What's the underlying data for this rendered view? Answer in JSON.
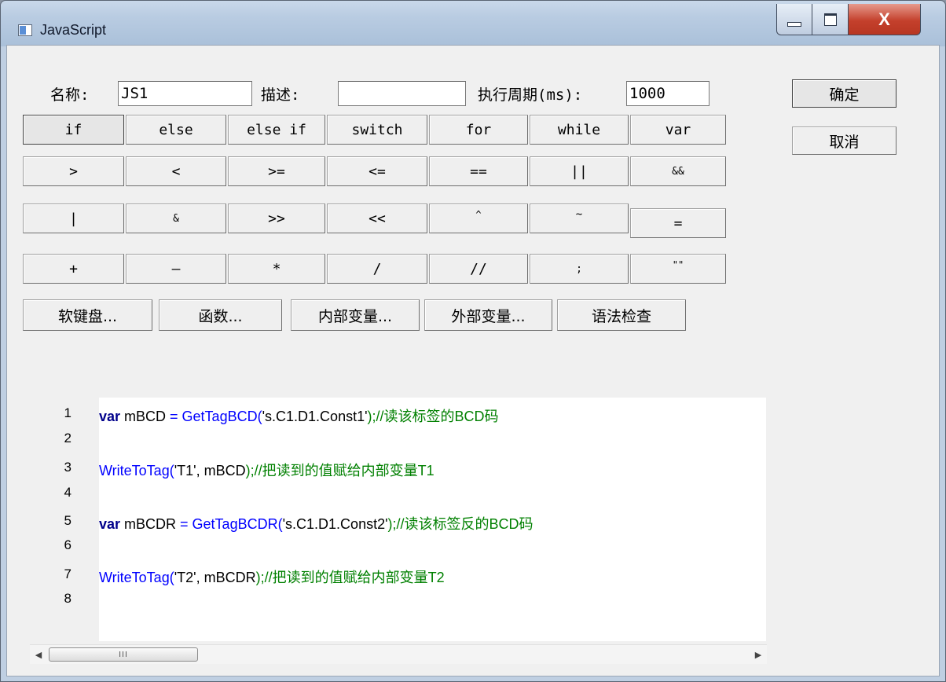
{
  "window": {
    "title": "JavaScript",
    "close_glyph": "X"
  },
  "form": {
    "name_label": "名称:",
    "name_value": "JS1",
    "desc_label": "描述:",
    "desc_value": "",
    "period_label": "执行周期(ms):",
    "period_value": "1000"
  },
  "actions": {
    "ok": "确定",
    "cancel": "取消"
  },
  "keys": {
    "row1": [
      "if",
      "else",
      "else if",
      "switch",
      "for",
      "while",
      "var"
    ],
    "row2": [
      ">",
      "<",
      ">=",
      "<=",
      "==",
      "||",
      "&&"
    ],
    "row3": [
      "|",
      "&",
      ">>",
      "<<",
      "^",
      "~",
      "="
    ],
    "row4": [
      "+",
      "—",
      "*",
      "/",
      "//",
      ";",
      "\"\""
    ]
  },
  "tools": [
    "软键盘...",
    "函数...",
    "内部变量...",
    "外部变量...",
    "语法检查"
  ],
  "editor": {
    "line_numbers": [
      "1",
      "2",
      "3",
      "4",
      "5",
      "6",
      "7",
      "8"
    ],
    "l1": {
      "kw": "var",
      "a": " mBCD ",
      "op": "=",
      "fn": " GetTagBCD(",
      "str": "'s.C1.D1.Const1'",
      "cm": ");//读该标签的BCD码"
    },
    "l3": {
      "fn": "WriteToTag(",
      "str": "'T1', mBCD",
      "cm": ");//把读到的值赋给内部变量T1"
    },
    "l5": {
      "kw": "var",
      "a": " mBCDR ",
      "op": "=",
      "fn": " GetTagBCDR(",
      "str": "'s.C1.D1.Const2'",
      "cm": ");//读该标签反的BCD码"
    },
    "l7": {
      "fn": "WriteToTag(",
      "str": "'T2', mBCDR",
      "cm": ");//把读到的值赋给内部变量T2"
    }
  },
  "scrollbar": {
    "left_arrow": "◀",
    "right_arrow": "▶",
    "thumb_grip": "III"
  }
}
